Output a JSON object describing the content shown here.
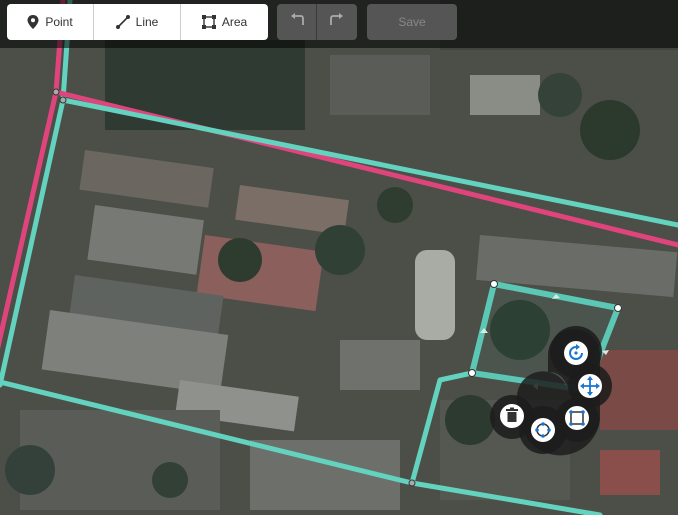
{
  "toolbar": {
    "modes": [
      {
        "label": "Point",
        "icon": "map-pin-icon"
      },
      {
        "label": "Line",
        "icon": "line-icon"
      },
      {
        "label": "Area",
        "icon": "area-icon"
      }
    ],
    "undo_icon": "undo-icon",
    "redo_icon": "redo-icon",
    "save_label": "Save"
  },
  "edit_menu": {
    "items": [
      "rotate-icon",
      "move-icon",
      "delete-icon",
      "circularize-icon",
      "square-icon"
    ]
  },
  "colors": {
    "selected_way": "#5ed4c0",
    "road_primary": "#e0447c",
    "road_secondary": "#63d3bf",
    "menu_bg": "#1d1d1d",
    "menu_icon_blue": "#1a76d2"
  }
}
